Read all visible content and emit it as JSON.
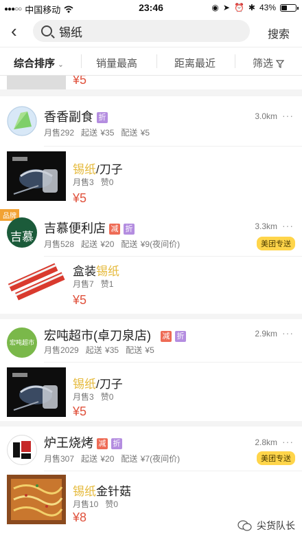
{
  "status": {
    "carrier": "中国移动",
    "time": "23:46",
    "battery": "43%",
    "battery_level": 0.43
  },
  "search": {
    "query": "锡纸",
    "button": "搜索"
  },
  "filters": [
    "综合排序",
    "销量最高",
    "距离最近",
    "筛选"
  ],
  "top_partial_price": "¥5",
  "shops": [
    {
      "name": "香香副食",
      "tags": [
        "折"
      ],
      "monthly_sales": "月售292",
      "min_order": "起送 ¥35",
      "delivery_fee": "配送 ¥5",
      "distance": "3.0km",
      "badge": "",
      "product": {
        "name_hl": "锡纸",
        "name_rest": "/刀子",
        "sales": "月售3",
        "likes": "赞0",
        "price": "¥5"
      }
    },
    {
      "name": "吉慕便利店",
      "ribbon": "品牌",
      "logo_text": "吉慕",
      "tags": [
        "减",
        "折"
      ],
      "monthly_sales": "月售528",
      "min_order": "起送 ¥20",
      "delivery_fee": "配送 ¥9(夜间价)",
      "distance": "3.3km",
      "badge": "美团专送",
      "product": {
        "name_pre": "盒装",
        "name_hl": "锡纸",
        "name_rest": "",
        "sales": "月售7",
        "likes": "赞1",
        "price": "¥5"
      }
    },
    {
      "name": "宏吨超市(卓刀泉店)",
      "logo_text": "宏吨超市",
      "tags": [
        "减",
        "折"
      ],
      "monthly_sales": "月售2029",
      "min_order": "起送 ¥35",
      "delivery_fee": "配送 ¥5",
      "distance": "2.9km",
      "badge": "",
      "product": {
        "name_hl": "锡纸",
        "name_rest": "/刀子",
        "sales": "月售3",
        "likes": "赞0",
        "price": "¥5"
      }
    },
    {
      "name": "炉王烧烤",
      "tags": [
        "减",
        "折"
      ],
      "monthly_sales": "月售307",
      "min_order": "起送 ¥20",
      "delivery_fee": "配送 ¥7(夜间价)",
      "distance": "2.8km",
      "badge": "美团专送",
      "product": {
        "name_hl": "锡纸",
        "name_rest": "金针菇",
        "sales": "月售10",
        "likes": "赞0",
        "price": "¥8"
      }
    }
  ],
  "watermark": "尖货队长"
}
